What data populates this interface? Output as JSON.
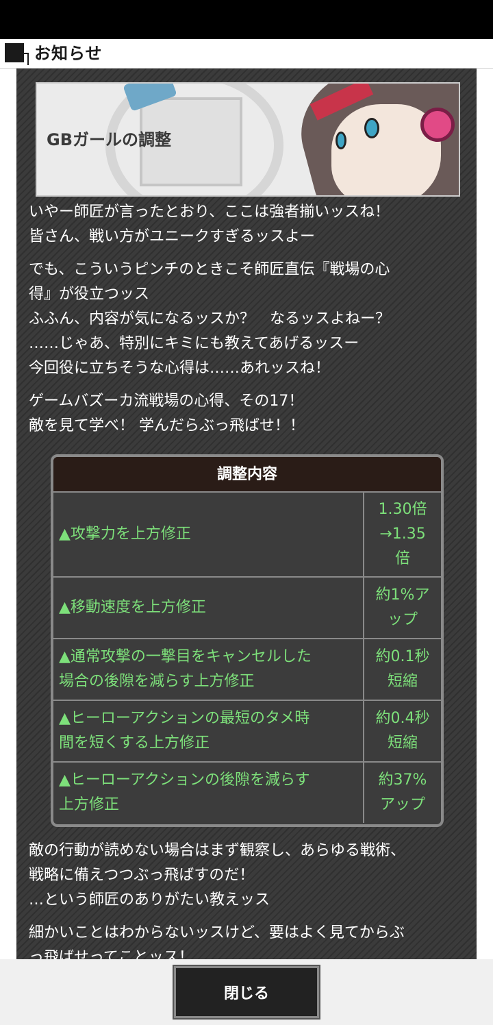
{
  "header": {
    "title": "お知らせ"
  },
  "banner": {
    "title": "GBガールの調整"
  },
  "paragraphs": [
    {
      "lines": [
        "いやー師匠が言ったとおり、ここは強者揃いッスね！",
        "皆さん、戦い方がユニークすぎるッスよー"
      ]
    },
    {
      "lines": [
        "でも、こういうピンチのときこそ師匠直伝『戦場の心",
        "得』が役立つッス",
        "ふふん、内容が気になるッスか？　なるッスよねー？",
        "……じゃあ、特別にキミにも教えてあげるッスー",
        "今回役に立ちそうな心得は……あれッスね！"
      ]
    },
    {
      "lines": [
        "ゲームバズーカ流戦場の心得、その17！",
        "敵を見て学べ！ 学んだらぶっ飛ばせ！！"
      ]
    }
  ],
  "table": {
    "header": "調整内容",
    "rows": [
      {
        "name": "▲攻撃力を上方修正",
        "value": "1.30倍\n→1.35\n倍"
      },
      {
        "name": "▲移動速度を上方修正",
        "value": "約1%ア\nップ"
      },
      {
        "name": "▲通常攻撃の一撃目をキャンセルした\n場合の後隙を減らす上方修正",
        "value": "約0.1秒\n短縮"
      },
      {
        "name": "▲ヒーローアクションの最短のタメ時\n間を短くする上方修正",
        "value": "約0.4秒\n短縮"
      },
      {
        "name": "▲ヒーローアクションの後隙を減らす\n上方修正",
        "value": "約37%\nアップ"
      }
    ]
  },
  "after_paragraphs": [
    {
      "lines": [
        "敵の行動が読めない場合はまず観察し、あらゆる戦術、",
        "戦略に備えつつぶっ飛ばすのだ！",
        "…という師匠のありがたい教えッス"
      ]
    },
    {
      "lines": [
        "細かいことはわからないッスけど、要はよく見てからぶ",
        "っ飛ばせってことッス！"
      ]
    }
  ],
  "footer": {
    "close_label": "閉じる"
  }
}
